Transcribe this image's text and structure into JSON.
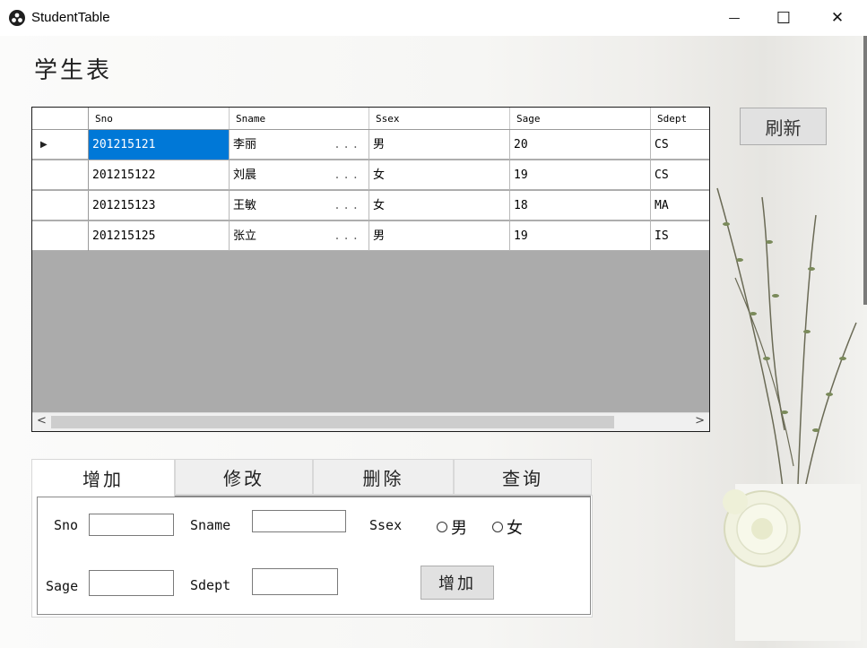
{
  "window": {
    "title": "StudentTable",
    "minimize_glyph": "—",
    "maximize_glyph": "☐",
    "close_glyph": "✕"
  },
  "heading": "学生表",
  "grid": {
    "columns": [
      "Sno",
      "Sname",
      "Ssex",
      "Sage",
      "Sdept"
    ],
    "rows": [
      {
        "sno": "201215121",
        "sname": "李丽",
        "ssex": "男",
        "sage": "20",
        "sdept": "CS",
        "selected": true
      },
      {
        "sno": "201215122",
        "sname": "刘晨",
        "ssex": "女",
        "sage": "19",
        "sdept": "CS"
      },
      {
        "sno": "201215123",
        "sname": "王敏",
        "ssex": "女",
        "sage": "18",
        "sdept": "MA"
      },
      {
        "sno": "201215125",
        "sname": "张立",
        "ssex": "男",
        "sage": "19",
        "sdept": "IS"
      }
    ],
    "ellipsis": "...",
    "current_row_marker": "▶",
    "scroll_left": "<",
    "scroll_right": ">"
  },
  "refresh_label": "刷新",
  "tabs": [
    "增加",
    "修改",
    "删除",
    "查询"
  ],
  "form": {
    "sno_label": "Sno",
    "sname_label": "Sname",
    "ssex_label": "Ssex",
    "sage_label": "Sage",
    "sdept_label": "Sdept",
    "radio_male": "男",
    "radio_female": "女",
    "sno_value": "",
    "sname_value": "",
    "sage_value": "",
    "sdept_value": "",
    "add_button": "增加"
  },
  "colors": {
    "selection": "#0078d7",
    "grid_background": "#ababab"
  },
  "icons": [
    "app-icon",
    "minimize-icon",
    "maximize-icon",
    "close-icon",
    "row-pointer-icon"
  ]
}
